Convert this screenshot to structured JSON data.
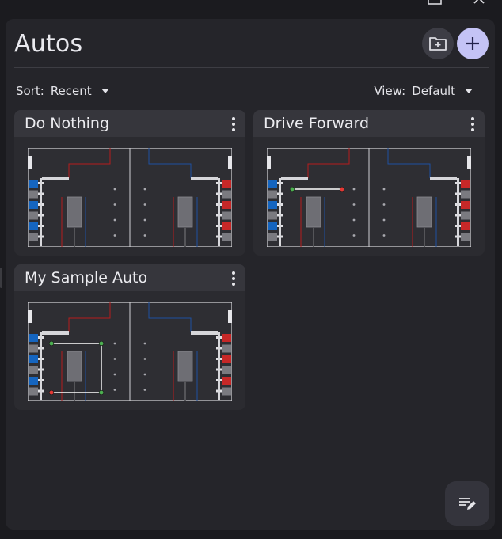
{
  "header": {
    "title": "Autos"
  },
  "toolbar": {
    "sort_label": "Sort:",
    "sort_value": "Recent",
    "view_label": "View:",
    "view_value": "Default"
  },
  "autos": [
    {
      "name": "Do Nothing",
      "path": "none"
    },
    {
      "name": "Drive Forward",
      "path": "line"
    },
    {
      "name": "My Sample Auto",
      "path": "loop"
    }
  ],
  "colors": {
    "background": "#1b1b1f",
    "panel": "#25252a",
    "card": "#2b2b30",
    "accent_button": "#c4c3f5",
    "blue_alliance": "#1565c0",
    "red_alliance": "#c62828"
  },
  "icons": {
    "new_folder": "new-folder-icon",
    "add": "add-icon",
    "card_menu": "more-vert-icon",
    "edit_notes": "edit-notes-icon"
  }
}
